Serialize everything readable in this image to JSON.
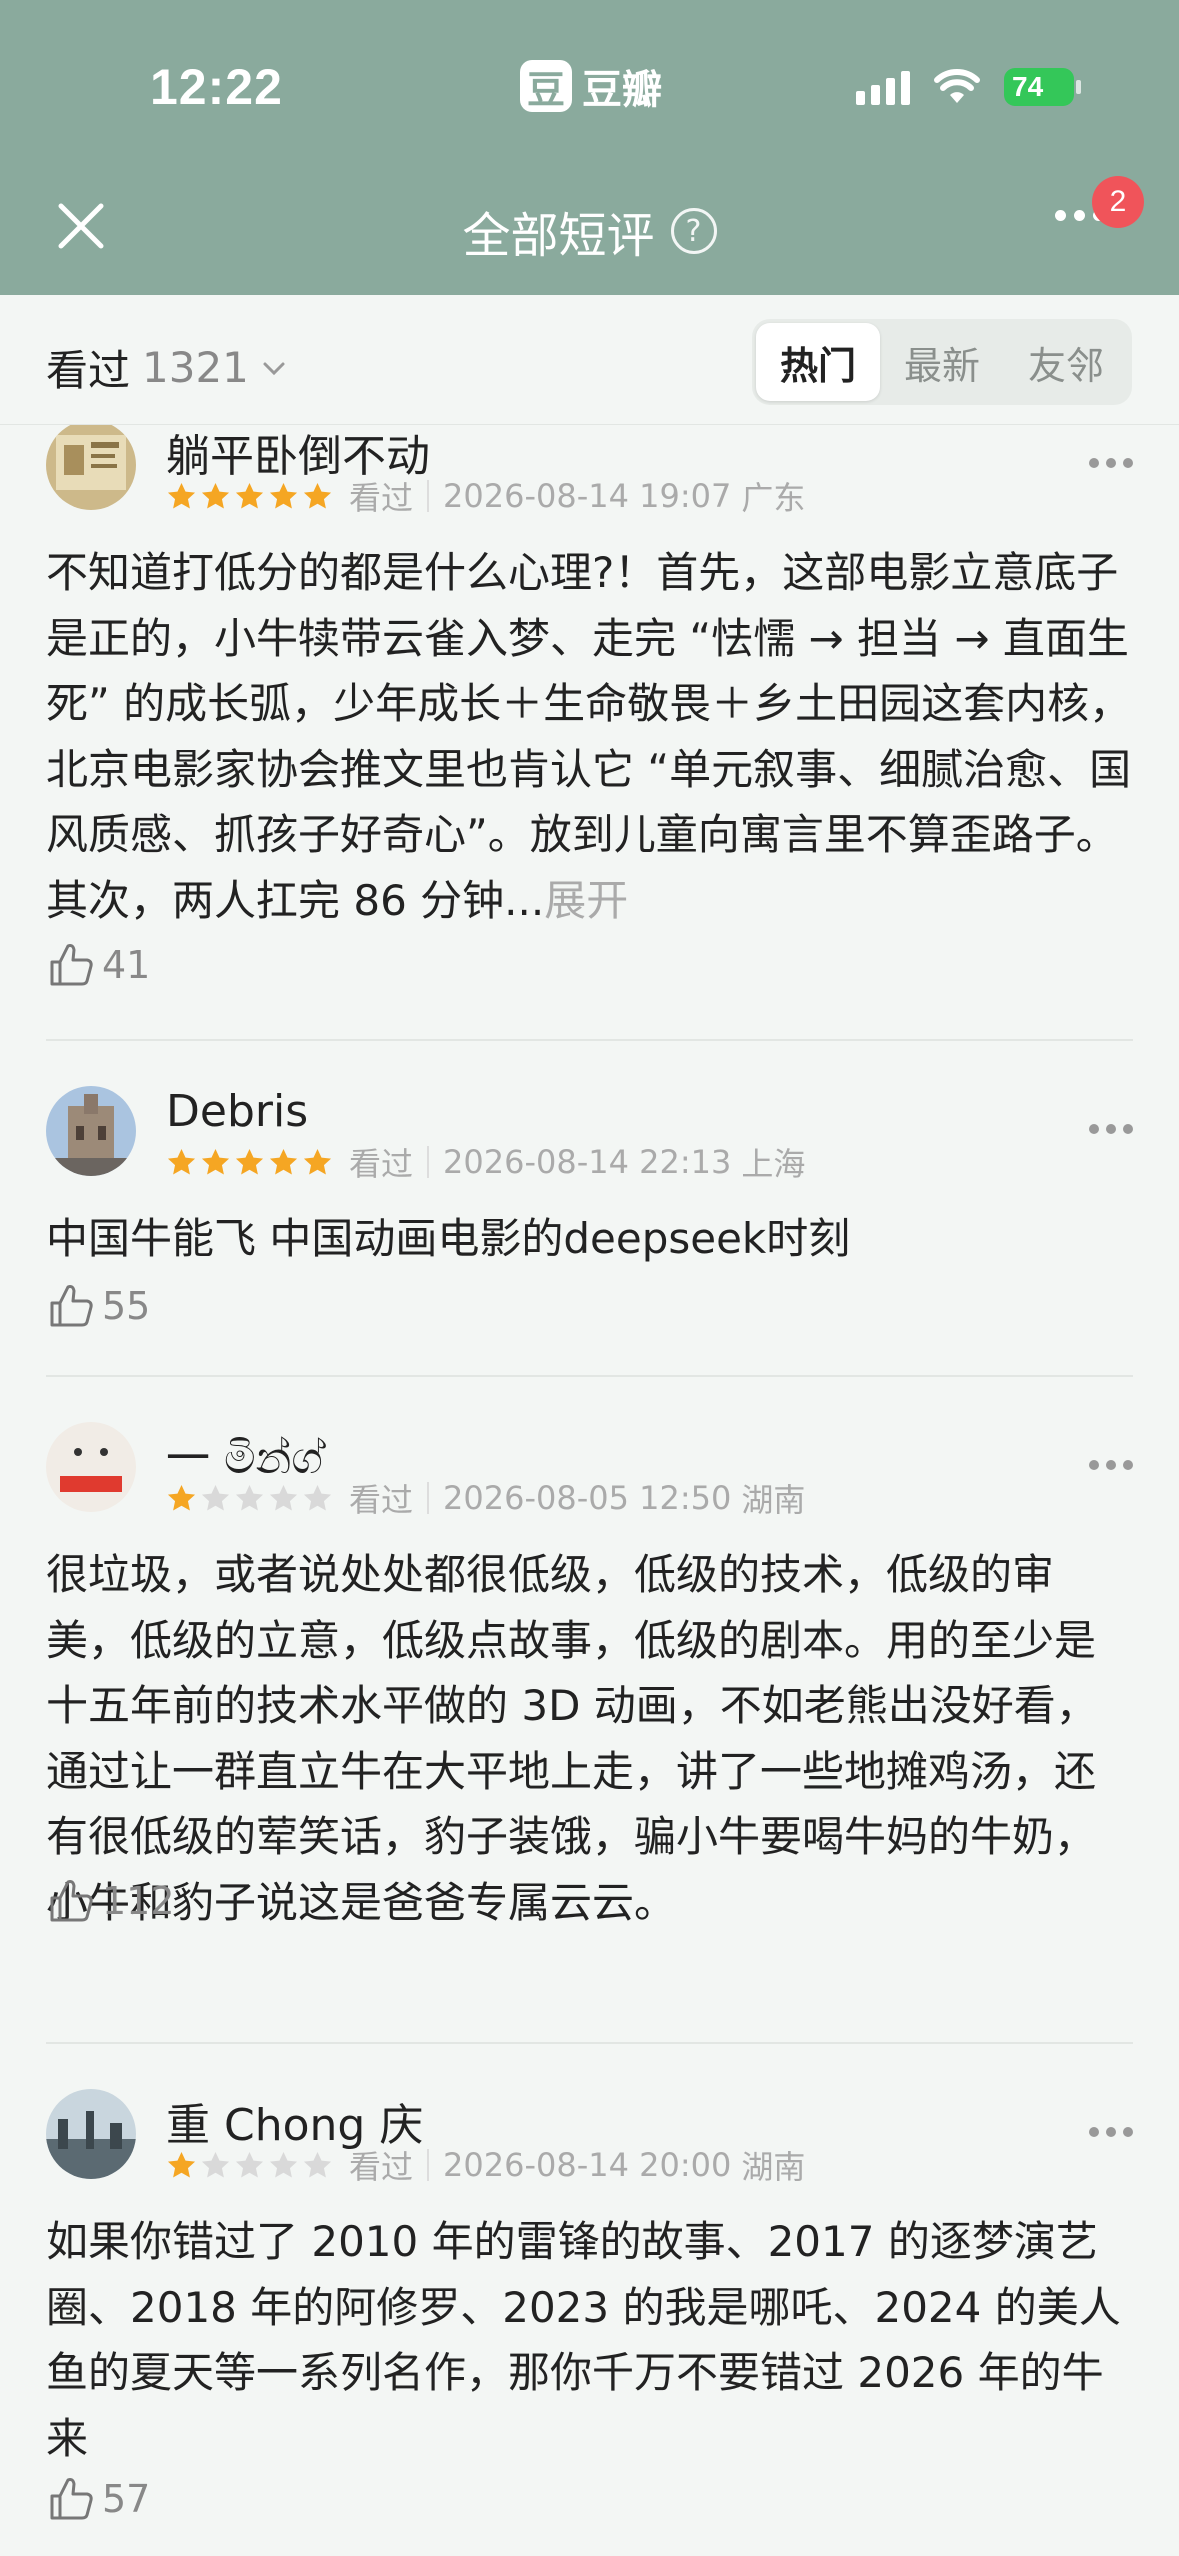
{
  "status_bar": {
    "time": "12:22",
    "app_logo": "豆",
    "app_name": "豆瓣",
    "battery": "74"
  },
  "nav": {
    "title": "全部短评",
    "help": "?",
    "badge": "2"
  },
  "filter": {
    "label": "看过",
    "count": "1321",
    "tabs": [
      "热门",
      "最新",
      "友邻"
    ],
    "active_tab": "热门"
  },
  "colors": {
    "header_bg": "#8aaa9d",
    "star_on": "#f5a623",
    "star_off": "#d9d9d9",
    "badge": "#f0545a",
    "battery": "#34c759"
  },
  "reviews": [
    {
      "name": "躺平卧倒不动",
      "rating": 5,
      "status": "看过",
      "date": "2026-08-14 19:07",
      "location": "广东",
      "text": "不知道打低分的都是什么心理?！首先，这部电影立意底子是正的，小牛犊带云雀入梦、走完 “怯懦 → 担当 → 直面生死” 的成长弧，少年成长＋生命敬畏＋乡土田园这套内核，北京电影家协会推文里也肯认它 “单元叙事、细腻治愈、国风质感、抓孩子好奇心”。放到儿童向寓言里不算歪路子。其次，两人扛完 86 分钟...",
      "expand": "展开",
      "likes": "41"
    },
    {
      "name": "Debris",
      "rating": 5,
      "status": "看过",
      "date": "2026-08-14 22:13",
      "location": "上海",
      "text": "中国牛能飞 中国动画电影的deepseek时刻",
      "likes": "55"
    },
    {
      "name": "一 මින්ග්",
      "rating": 1,
      "status": "看过",
      "date": "2026-08-05 12:50",
      "location": "湖南",
      "text": "很垃圾，或者说处处都很低级，低级的技术，低级的审美，低级的立意，低级点故事，低级的剧本。用的至少是十五年前的技术水平做的 3D 动画，不如老熊出没好看，通过让一群直立牛在大平地上走，讲了一些地摊鸡汤，还有很低级的荤笑话，豹子装饿，骗小牛要喝牛妈的牛奶，小牛和豹子说这是爸爸专属云云。",
      "likes": "112"
    },
    {
      "name": "重 Chong 庆",
      "rating": 1,
      "status": "看过",
      "date": "2026-08-14 20:00",
      "location": "湖南",
      "text": "如果你错过了 2010 年的雷锋的故事、2017 的逐梦演艺圈、2018 年的阿修罗、2023 的我是哪吒、2024 的美人鱼的夏天等一系列名作，那你千万不要错过 2026 年的牛来",
      "likes": "57"
    }
  ]
}
